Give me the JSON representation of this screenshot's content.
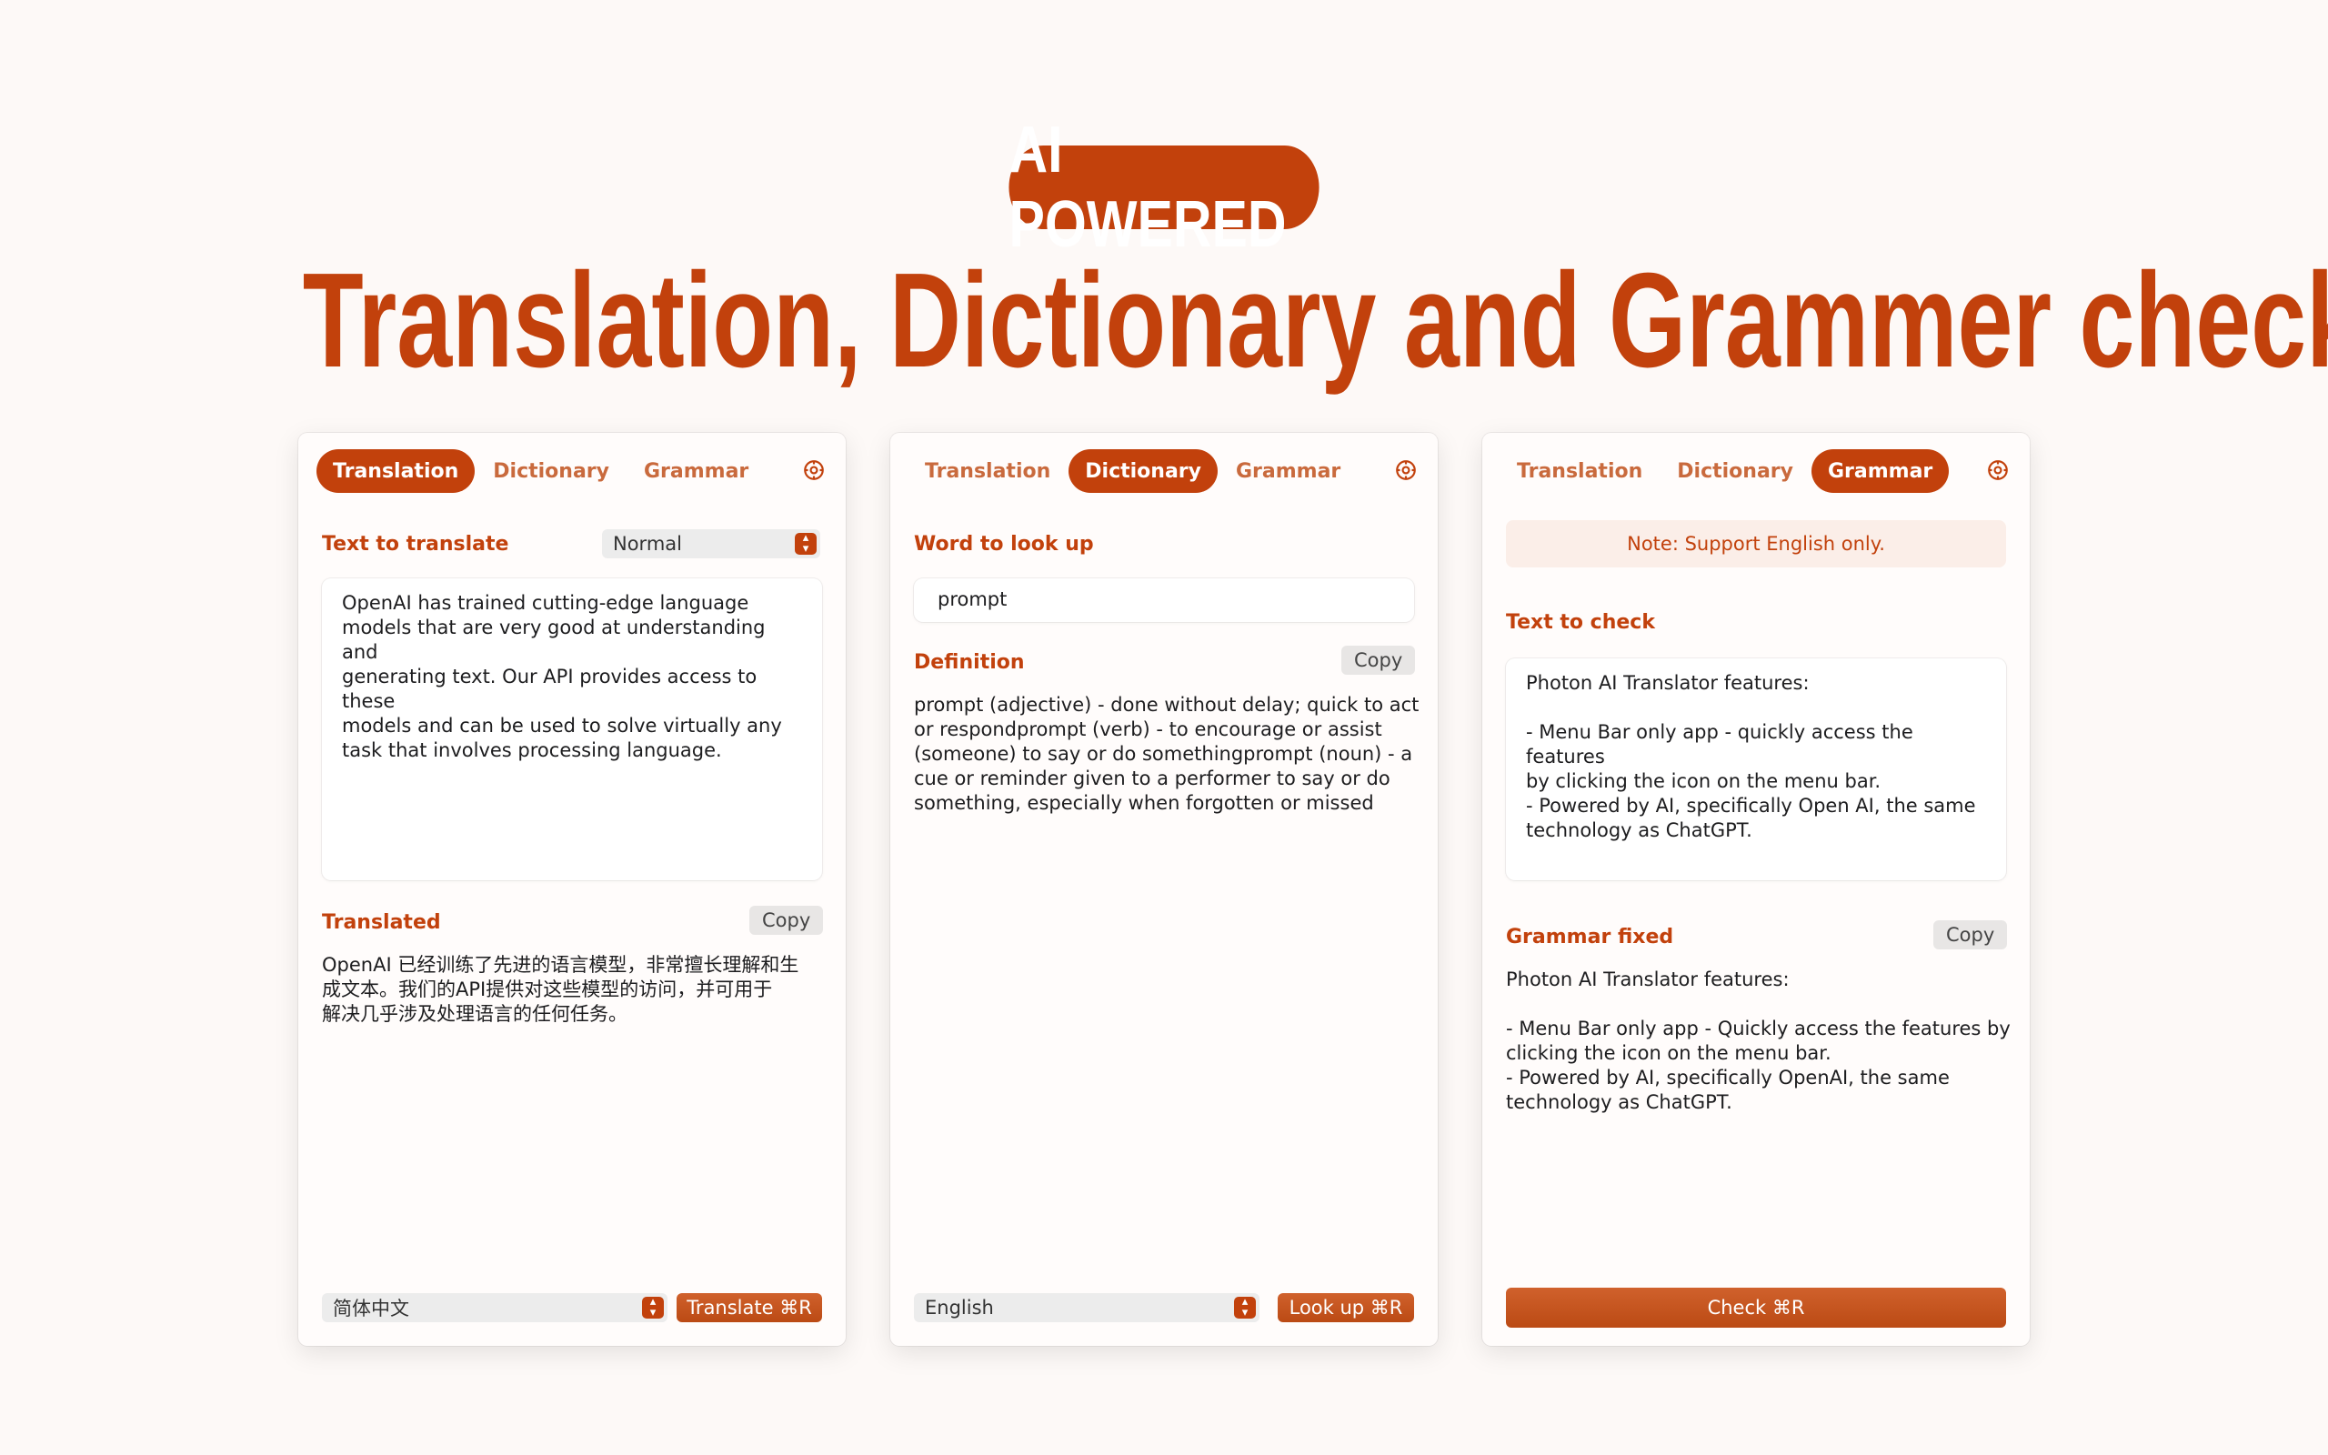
{
  "hero": {
    "badge": "AI POWERED",
    "headline": "Translation, Dictionary and Grammer check"
  },
  "tabs": [
    "Translation",
    "Dictionary",
    "Grammar"
  ],
  "icons": {
    "settings": "gear-icon",
    "stepper": "chevron-up-down-icon"
  },
  "colors": {
    "accent": "#c2410c",
    "background": "#fdf9f7"
  },
  "translation_panel": {
    "input_label": "Text to translate",
    "mode_select": "Normal",
    "input_text": "OpenAI has trained cutting-edge language\nmodels that are very good at understanding and\ngenerating text. Our API provides access to these\nmodels and can be used to solve virtually any\ntask that involves processing language.",
    "output_label": "Translated",
    "copy_label": "Copy",
    "output_text": "OpenAI 已经训练了先进的语言模型，非常擅长理解和生\n成文本。我们的API提供对这些模型的访问，并可用于\n解决几乎涉及处理语言的任何任务。",
    "language_select": "简体中文",
    "action_label": "Translate ⌘R"
  },
  "dictionary_panel": {
    "input_label": "Word to look up",
    "input_value": "prompt",
    "definition_label": "Definition",
    "copy_label": "Copy",
    "definition_text": "prompt (adjective) - done without delay; quick to act\nor respondprompt (verb) - to encourage or assist\n(someone) to say or do somethingprompt (noun) - a\ncue or reminder given to a performer to say or do\nsomething, especially when forgotten or missed",
    "language_select": "English",
    "action_label": "Look up ⌘R"
  },
  "grammar_panel": {
    "note": "Note: Support English only.",
    "input_label": "Text to check",
    "input_text": "Photon AI Translator features:\n\n- Menu Bar only app - quickly access the features\nby clicking the icon on the menu bar.\n- Powered by AI, specifically Open AI, the same\ntechnology as ChatGPT.",
    "output_label": "Grammar fixed",
    "copy_label": "Copy",
    "output_text": "Photon AI Translator features:\n\n- Menu Bar only app - Quickly access the features by\nclicking the icon on the menu bar.\n- Powered by AI, specifically OpenAI, the same\ntechnology as ChatGPT.",
    "action_label": "Check ⌘R"
  }
}
